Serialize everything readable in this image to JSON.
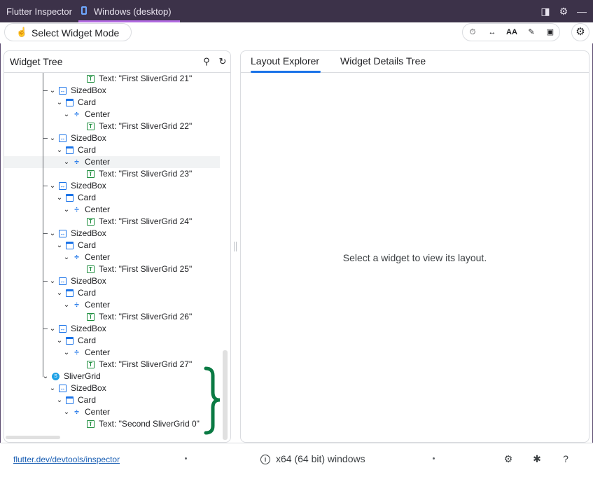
{
  "top_tabs": [
    {
      "label": "Flutter Inspector"
    },
    {
      "label": "Windows (desktop)"
    }
  ],
  "toolbar": {
    "select_mode_label": "Select Widget Mode"
  },
  "widget_tree": {
    "title": "Widget Tree",
    "rows": [
      {
        "kind": "text",
        "label": "Text: \"First SliverGrid 21\""
      },
      {
        "kind": "sized",
        "label": "SizedBox"
      },
      {
        "kind": "card",
        "label": "Card"
      },
      {
        "kind": "center",
        "label": "Center"
      },
      {
        "kind": "text",
        "label": "Text: \"First SliverGrid 22\""
      },
      {
        "kind": "sized",
        "label": "SizedBox"
      },
      {
        "kind": "card",
        "label": "Card"
      },
      {
        "kind": "center",
        "label": "Center"
      },
      {
        "kind": "text",
        "label": "Text: \"First SliverGrid 23\""
      },
      {
        "kind": "sized",
        "label": "SizedBox"
      },
      {
        "kind": "card",
        "label": "Card"
      },
      {
        "kind": "center",
        "label": "Center"
      },
      {
        "kind": "text",
        "label": "Text: \"First SliverGrid 24\""
      },
      {
        "kind": "sized",
        "label": "SizedBox"
      },
      {
        "kind": "card",
        "label": "Card"
      },
      {
        "kind": "center",
        "label": "Center"
      },
      {
        "kind": "text",
        "label": "Text: \"First SliverGrid 25\""
      },
      {
        "kind": "sized",
        "label": "SizedBox"
      },
      {
        "kind": "card",
        "label": "Card"
      },
      {
        "kind": "center",
        "label": "Center"
      },
      {
        "kind": "text",
        "label": "Text: \"First SliverGrid 26\""
      },
      {
        "kind": "sized",
        "label": "SizedBox"
      },
      {
        "kind": "card",
        "label": "Card"
      },
      {
        "kind": "center",
        "label": "Center"
      },
      {
        "kind": "text",
        "label": "Text: \"First SliverGrid 27\""
      },
      {
        "kind": "sliver",
        "label": "SliverGrid"
      },
      {
        "kind": "sized",
        "label": "SizedBox"
      },
      {
        "kind": "card",
        "label": "Card"
      },
      {
        "kind": "center",
        "label": "Center"
      },
      {
        "kind": "text",
        "label": "Text: \"Second SliverGrid 0\""
      }
    ]
  },
  "details": {
    "tabs": [
      {
        "label": "Layout Explorer"
      },
      {
        "label": "Widget Details Tree"
      }
    ],
    "empty_message": "Select a widget to view its layout."
  },
  "status_bar": {
    "link": "flutter.dev/devtools/inspector",
    "platform": "x64 (64 bit) windows"
  },
  "colors": {
    "titlebar": "#3c3249",
    "active_tab_underline": "#b16ae0",
    "accent": "#1a73e8",
    "text_widget_icon": "#1e8e3e",
    "bracket": "#0a7a43"
  }
}
